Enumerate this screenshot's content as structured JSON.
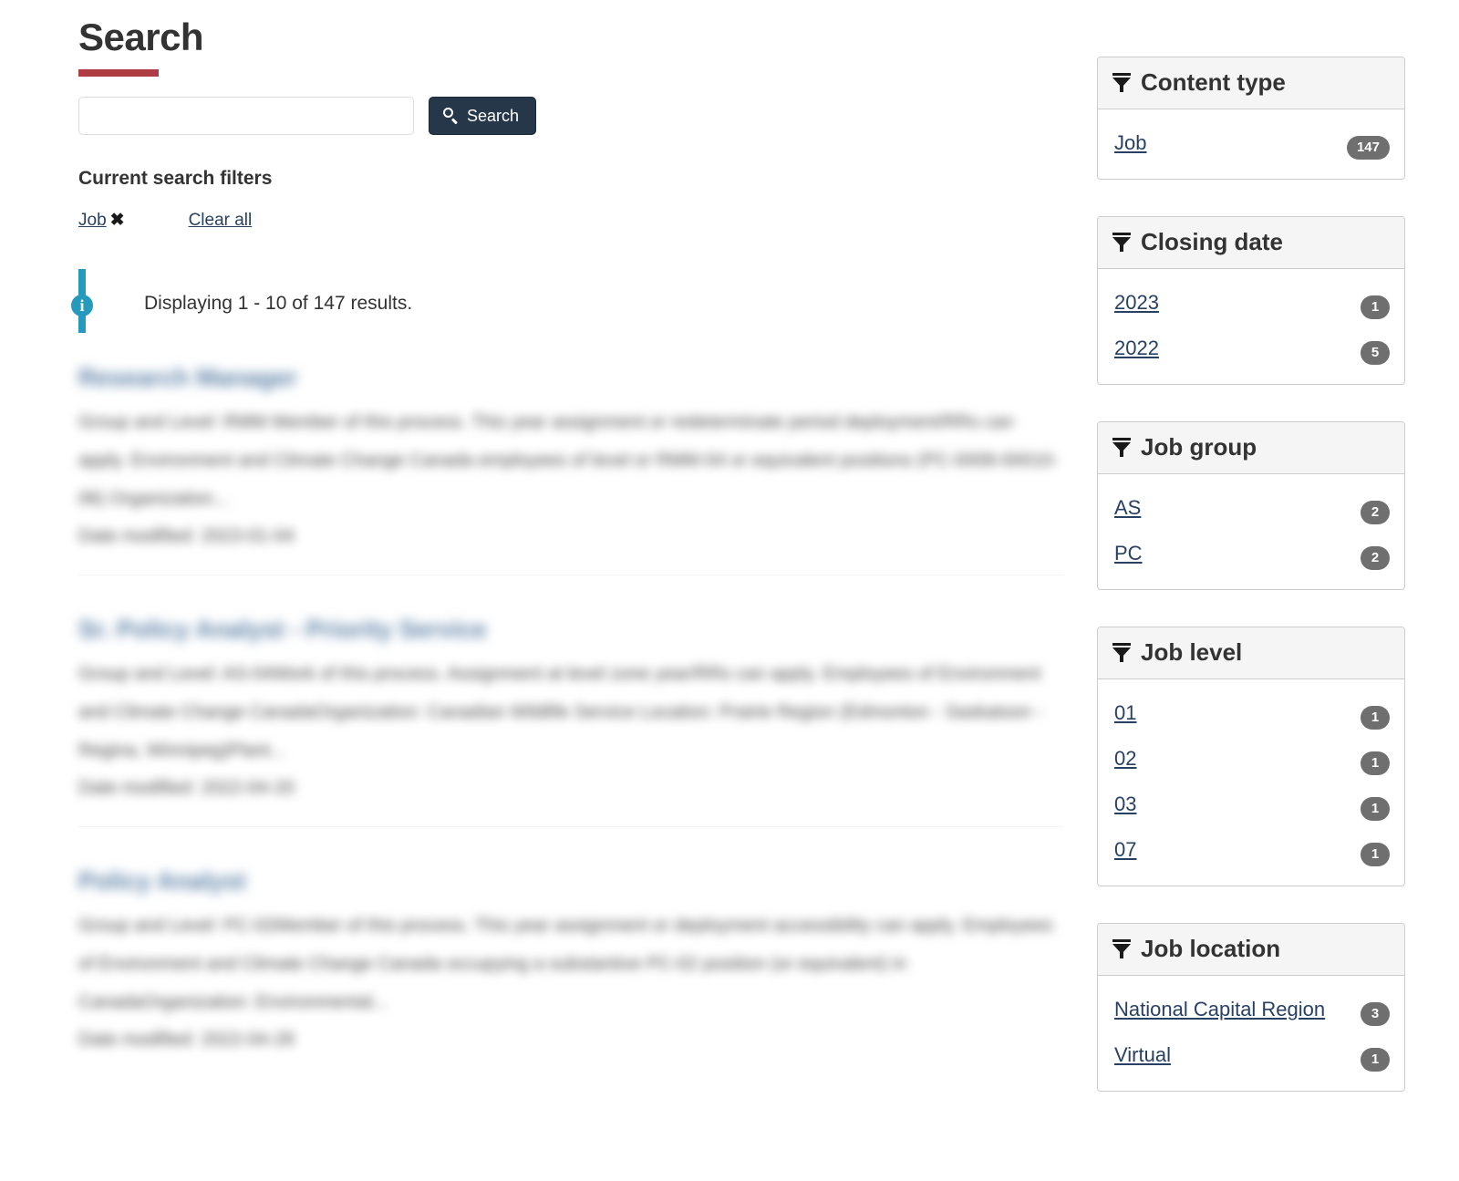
{
  "page": {
    "title": "Search",
    "accent_red": "#af3c43",
    "link_color": "#284162",
    "button_color": "#26374a",
    "info_color": "#269abc",
    "badge_color": "#6f6f6f"
  },
  "search": {
    "value": "",
    "placeholder": "",
    "button_label": "Search",
    "button_icon": "search-icon"
  },
  "filters": {
    "heading": "Current search filters",
    "chips": [
      {
        "label": "Job",
        "remove_icon": "✖"
      }
    ],
    "clear_all_label": "Clear all"
  },
  "alert": {
    "icon": "info-icon",
    "text": "Displaying 1 - 10 of 147 results."
  },
  "results": [
    {
      "title": "Research Manager",
      "snippet": "Group and Level: RMM Member of this process. This year assignment or redeterminate period deployment/RRs can apply. Environment and Climate Change Canada employees of level or RMM-04 or equivalent positions (PC-0008-00010-06) Organization...",
      "date": "Date modified: 2023-01-04"
    },
    {
      "title": "Sr. Policy Analyst - Priority Service",
      "snippet": "Group and Level: AS-04Work of this process. Assignment at level zone year/RRs can apply. Employees of Environment and Climate Change CanadaOrganization: Canadian Wildlife Service Location: Prairie Region (Edmonton - Saskatoon - Regina, Winnipeg)Plant...",
      "date": "Date modified: 2022-04-20"
    },
    {
      "title": "Policy Analyst",
      "snippet": "Group and Level: PC-02Member of this process. This year assignment or deployment accessibility can apply. Employees of Environment and Climate Change Canada occupying a substantive PC-02 position (or equivalent) in CanadaOrganization: Environmental...",
      "date": "Date modified: 2022-04-28"
    }
  ],
  "facets": [
    {
      "id": "content-type",
      "title": "Content type",
      "icon": "funnel-icon",
      "items": [
        {
          "label": "Job",
          "count": "147"
        }
      ]
    },
    {
      "id": "closing-date",
      "title": "Closing date",
      "icon": "funnel-icon",
      "items": [
        {
          "label": "2023",
          "count": "1"
        },
        {
          "label": "2022",
          "count": "5"
        }
      ]
    },
    {
      "id": "job-group",
      "title": "Job group",
      "icon": "funnel-icon",
      "items": [
        {
          "label": "AS",
          "count": "2"
        },
        {
          "label": "PC",
          "count": "2"
        }
      ]
    },
    {
      "id": "job-level",
      "title": "Job level",
      "icon": "funnel-icon",
      "items": [
        {
          "label": "01",
          "count": "1"
        },
        {
          "label": "02",
          "count": "1"
        },
        {
          "label": "03",
          "count": "1"
        },
        {
          "label": "07",
          "count": "1"
        }
      ]
    },
    {
      "id": "job-location",
      "title": "Job location",
      "icon": "funnel-icon",
      "items": [
        {
          "label": "National Capital Region",
          "count": "3"
        },
        {
          "label": "Virtual",
          "count": "1"
        }
      ]
    }
  ]
}
